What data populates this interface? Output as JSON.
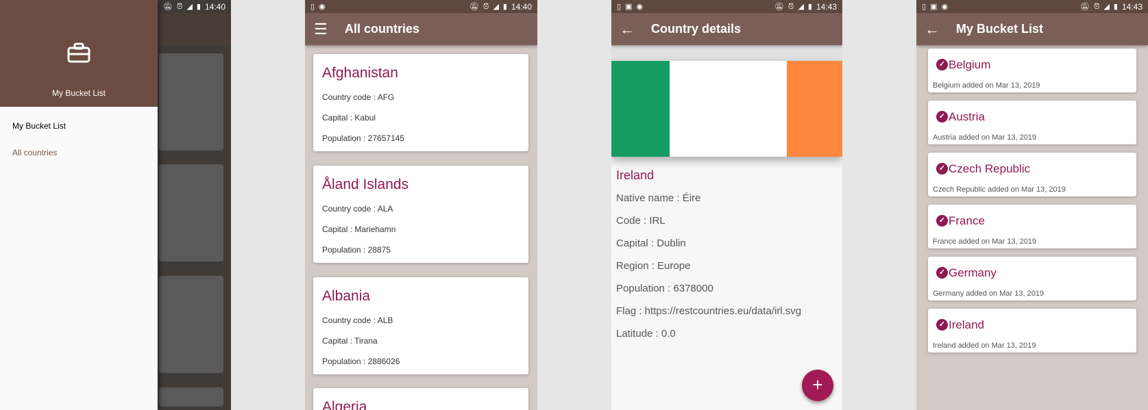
{
  "status_icons": [
    "sim-icon",
    "image-icon",
    "circle-icon",
    "mute-bell-icon",
    "alarm-icon",
    "signal-icon",
    "battery-icon"
  ],
  "screen1": {
    "time": "14:40",
    "drawer_title": "My Bucket List",
    "items": [
      {
        "label": "My Bucket List"
      },
      {
        "label": "All countries"
      }
    ]
  },
  "screen2": {
    "time": "14:40",
    "title": "All countries",
    "countries": [
      {
        "name": "Afghanistan",
        "code": "Country code : AFG",
        "capital": "Capital : Kabul",
        "population": "Population : 27657145"
      },
      {
        "name": "Åland Islands",
        "code": "Country code : ALA",
        "capital": "Capital : Mariehamn",
        "population": "Population : 28875"
      },
      {
        "name": "Albania",
        "code": "Country code : ALB",
        "capital": "Capital : Tirana",
        "population": "Population : 2886026"
      },
      {
        "name": "Algeria"
      }
    ]
  },
  "screen3": {
    "time": "14:43",
    "title": "Country details",
    "name": "Ireland",
    "lines": [
      "Native name : Éire",
      "Code : IRL",
      "Capital : Dublin",
      "Region : Europe",
      "Population : 6378000",
      "Flag : https://restcountries.eu/data/irl.svg",
      "Latitude : 0.0"
    ],
    "fab_label": "+",
    "flag_colors": [
      "#169b62",
      "#ffffff",
      "#ff883e"
    ]
  },
  "screen4": {
    "time": "14:43",
    "title": "My Bucket List",
    "items": [
      {
        "name": "Belgium",
        "sub": "Belgium added on Mar 13, 2019"
      },
      {
        "name": "Austria",
        "sub": "Austria added on Mar 13, 2019"
      },
      {
        "name": "Czech Republic",
        "sub": "Czech Republic added on Mar 13, 2019"
      },
      {
        "name": "France",
        "sub": "France added on Mar 13, 2019"
      },
      {
        "name": "Germany",
        "sub": "Germany added on Mar 13, 2019"
      },
      {
        "name": "Ireland",
        "sub": "Ireland added on Mar 13, 2019"
      }
    ]
  },
  "colors": {
    "primary": "#7a5f58",
    "accent": "#8e1a4f",
    "fab": "#a11a55"
  }
}
